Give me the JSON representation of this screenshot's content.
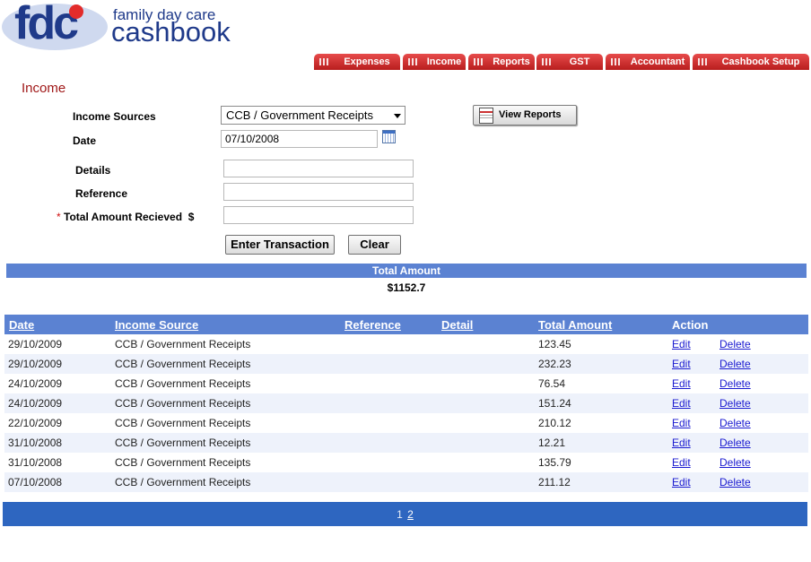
{
  "brand": {
    "logo": "fdc",
    "tagline": "family day care",
    "product": "cashbook"
  },
  "nav": [
    {
      "label": "Expenses"
    },
    {
      "label": "Income"
    },
    {
      "label": "Reports"
    },
    {
      "label": "GST"
    },
    {
      "label": "Accountant"
    },
    {
      "label": "Cashbook Setup"
    }
  ],
  "page_title": "Income",
  "form": {
    "income_sources_label": "Income Sources",
    "income_sources_value": "CCB / Government Receipts",
    "date_label": "Date",
    "date_value": "07/10/2008",
    "details_label": "Details",
    "details_value": "",
    "reference_label": "Reference",
    "reference_value": "",
    "required_marker": "*",
    "amount_label": "Total Amount Recieved",
    "currency_symbol": "$",
    "amount_value": "",
    "enter_button": "Enter Transaction",
    "clear_button": "Clear",
    "view_reports_button": "View Reports"
  },
  "summary": {
    "label": "Total Amount",
    "value": "$1152.7"
  },
  "table": {
    "headers": {
      "date": "Date",
      "source": "Income Source",
      "reference": "Reference",
      "detail": "Detail",
      "amount": "Total Amount",
      "action": "Action"
    },
    "rows": [
      {
        "date": "29/10/2009",
        "source": "CCB / Government Receipts",
        "reference": "",
        "detail": "",
        "amount": "123.45",
        "edit": "Edit",
        "delete": "Delete"
      },
      {
        "date": "29/10/2009",
        "source": "CCB / Government Receipts",
        "reference": "",
        "detail": "",
        "amount": "232.23",
        "edit": "Edit",
        "delete": "Delete"
      },
      {
        "date": "24/10/2009",
        "source": "CCB / Government Receipts",
        "reference": "",
        "detail": "",
        "amount": "76.54",
        "edit": "Edit",
        "delete": "Delete"
      },
      {
        "date": "24/10/2009",
        "source": "CCB / Government Receipts",
        "reference": "",
        "detail": "",
        "amount": "151.24",
        "edit": "Edit",
        "delete": "Delete"
      },
      {
        "date": "22/10/2009",
        "source": "CCB / Government Receipts",
        "reference": "",
        "detail": "",
        "amount": "210.12",
        "edit": "Edit",
        "delete": "Delete"
      },
      {
        "date": "31/10/2008",
        "source": "CCB / Government Receipts",
        "reference": "",
        "detail": "",
        "amount": "12.21",
        "edit": "Edit",
        "delete": "Delete"
      },
      {
        "date": "31/10/2008",
        "source": "CCB / Government Receipts",
        "reference": "",
        "detail": "",
        "amount": "135.79",
        "edit": "Edit",
        "delete": "Delete"
      },
      {
        "date": "07/10/2008",
        "source": "CCB / Government Receipts",
        "reference": "",
        "detail": "",
        "amount": "211.12",
        "edit": "Edit",
        "delete": "Delete"
      }
    ]
  },
  "pager": {
    "current": "1",
    "pages": [
      "2"
    ]
  },
  "colors": {
    "accent_blue": "#5b82d2",
    "pager_blue": "#2e66c0",
    "tab_red": "#d12c2c",
    "title_red": "#a01818"
  }
}
